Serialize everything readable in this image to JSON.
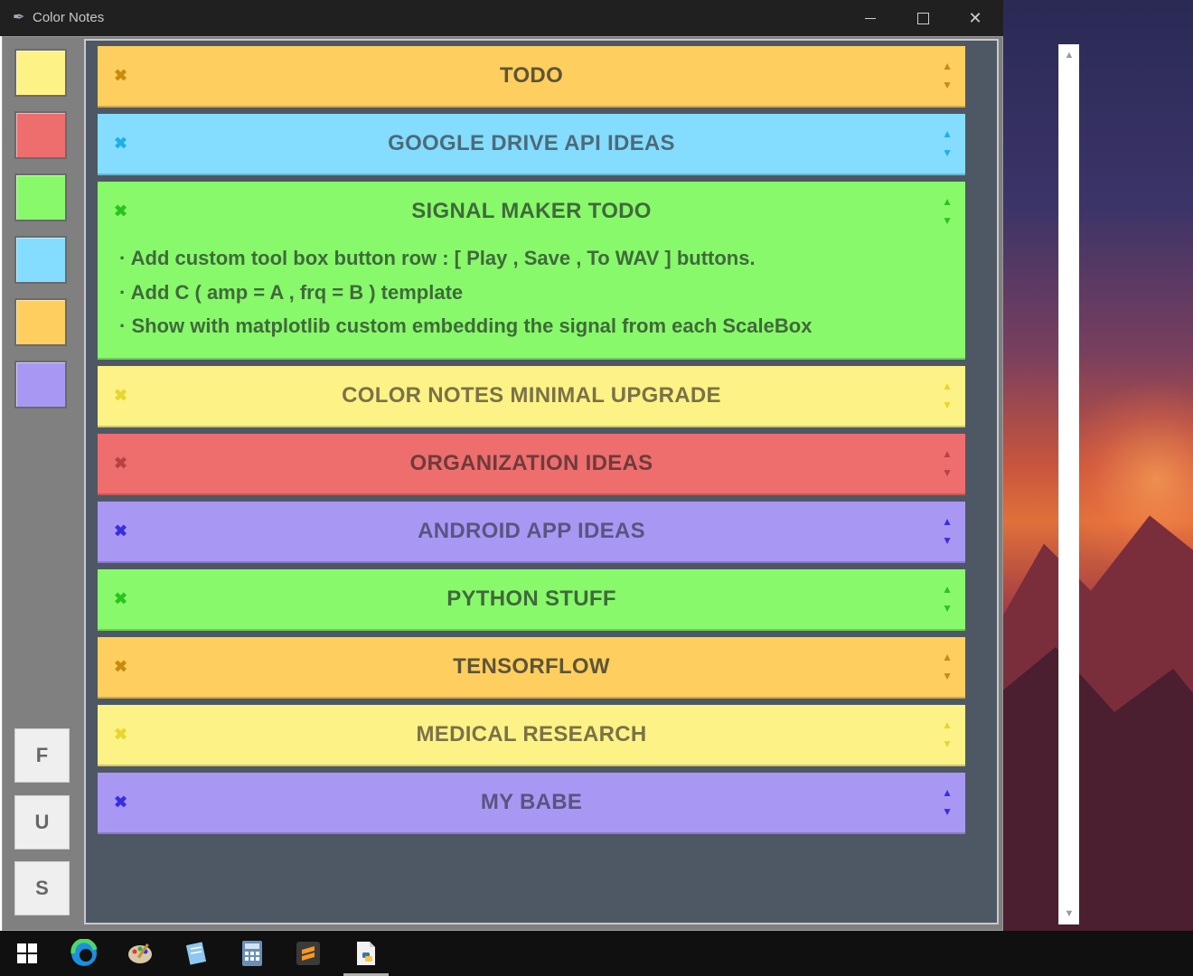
{
  "window": {
    "title": "Color Notes",
    "controls": {
      "minimize": "",
      "maximize": "",
      "close": "✕"
    }
  },
  "sidebar": {
    "swatches": [
      {
        "name": "yellow",
        "color": "#fdf286"
      },
      {
        "name": "red",
        "color": "#ee6e6e"
      },
      {
        "name": "green",
        "color": "#89f96c"
      },
      {
        "name": "blue",
        "color": "#84ddff"
      },
      {
        "name": "orange",
        "color": "#fecf5e"
      },
      {
        "name": "purple",
        "color": "#a898f4"
      }
    ],
    "buttons": [
      "F",
      "U",
      "S"
    ]
  },
  "notes": [
    {
      "title": "TODO",
      "bg": "#fecf5e",
      "text": "#5e5438",
      "accent": "#c88b10",
      "lines": []
    },
    {
      "title": "GOOGLE DRIVE API IDEAS",
      "bg": "#84ddff",
      "text": "#4d6a7a",
      "accent": "#22aee8",
      "lines": []
    },
    {
      "title": "SIGNAL MAKER TODO",
      "bg": "#89f96c",
      "text": "#3f6a3a",
      "accent": "#2bc41e",
      "lines": [
        "· Add custom tool box button row : [ Play , Save , To WAV  ] buttons.",
        "· Add C ( amp = A , frq = B ) template",
        "· Show with matplotlib custom embedding the signal from each ScaleBox"
      ]
    },
    {
      "title": "COLOR NOTES MINIMAL UPGRADE",
      "bg": "#fdf286",
      "text": "#7a7248",
      "accent": "#e7d62c",
      "lines": []
    },
    {
      "title": "ORGANIZATION IDEAS",
      "bg": "#ee6e6e",
      "text": "#6e3b3b",
      "accent": "#b84242",
      "lines": []
    },
    {
      "title": "ANDROID APP IDEAS",
      "bg": "#a898f4",
      "text": "#5a5480",
      "accent": "#3a2ee0",
      "lines": []
    },
    {
      "title": "PYTHON STUFF",
      "bg": "#89f96c",
      "text": "#3f6a3a",
      "accent": "#2bc41e",
      "lines": []
    },
    {
      "title": "TENSORFLOW",
      "bg": "#fecf5e",
      "text": "#5e5438",
      "accent": "#c88b10",
      "lines": []
    },
    {
      "title": "MEDICAL RESEARCH",
      "bg": "#fdf286",
      "text": "#7a7248",
      "accent": "#e7d62c",
      "lines": []
    },
    {
      "title": "MY BABE",
      "bg": "#a898f4",
      "text": "#5a5480",
      "accent": "#3a2ee0",
      "lines": []
    }
  ],
  "note_icons": {
    "delete": "✖",
    "up": "▲",
    "down": "▼"
  },
  "scrollbar": {
    "up": "▲",
    "down": "▼"
  },
  "taskbar": {
    "icons": [
      "windows-start-icon",
      "edge-browser-icon",
      "paint-palette-icon",
      "notepad-icon",
      "calculator-icon",
      "sublime-text-icon",
      "python-file-icon"
    ],
    "active": "python-file-icon"
  }
}
